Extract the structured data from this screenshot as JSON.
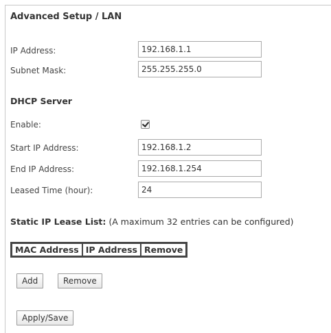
{
  "page": {
    "title": "Advanced Setup / LAN"
  },
  "lan": {
    "ip_label": "IP Address:",
    "ip_value": "192.168.1.1",
    "mask_label": "Subnet Mask:",
    "mask_value": "255.255.255.0"
  },
  "dhcp": {
    "section_title": "DHCP Server",
    "enable_label": "Enable:",
    "enable_checked": true,
    "start_label": "Start IP Address:",
    "start_value": "192.168.1.2",
    "end_label": "End IP Address:",
    "end_value": "192.168.1.254",
    "lease_label": "Leased Time (hour):",
    "lease_value": "24"
  },
  "static_lease": {
    "title": "Static IP Lease List:",
    "note": " (A maximum 32 entries can be configured)",
    "columns": [
      "MAC Address",
      "IP Address",
      "Remove"
    ]
  },
  "buttons": {
    "add": "Add",
    "remove": "Remove",
    "apply_save": "Apply/Save"
  }
}
